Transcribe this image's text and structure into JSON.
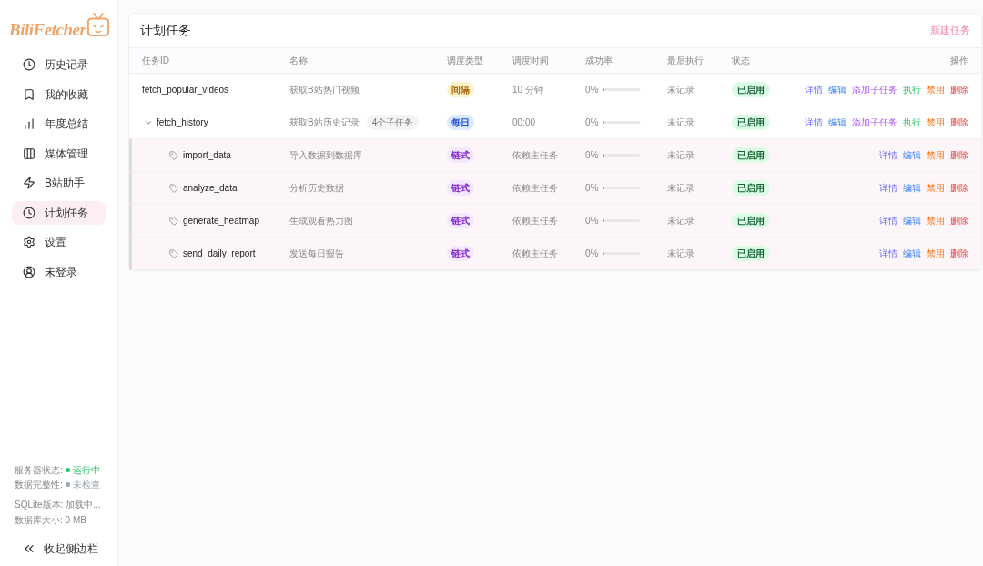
{
  "sidebar": {
    "logo": "BiliFetcher",
    "nav": [
      {
        "label": "历史记录",
        "selected": false
      },
      {
        "label": "我的收藏",
        "selected": false
      },
      {
        "label": "年度总结",
        "selected": false
      },
      {
        "label": "媒体管理",
        "selected": false
      },
      {
        "label": "B站助手",
        "selected": false
      },
      {
        "label": "计划任务",
        "selected": true
      },
      {
        "label": "设置",
        "selected": false
      },
      {
        "label": "未登录",
        "selected": false
      }
    ],
    "status": [
      {
        "label": "服务器状态:",
        "value": "运行中",
        "color": "#22c55e"
      },
      {
        "label": "数据完整性:",
        "value": "未检查",
        "color": "#9ca3af"
      }
    ],
    "info": [
      "SQLite版本: 加载中...",
      "数据库大小: 0 MB"
    ],
    "collapse": "收起侧边栏"
  },
  "page": {
    "title": "计划任务",
    "new_task": "新建任务"
  },
  "table": {
    "columns": [
      "任务ID",
      "名称",
      "调度类型",
      "调度时间",
      "成功率",
      "最后执行",
      "状态",
      "操作"
    ],
    "rows": [
      {
        "id": "fetch_popular_videos",
        "name": "获取B站热门视频",
        "schedule": {
          "kind": "interval",
          "label": "间隔"
        },
        "time": "10 分钟",
        "success": {
          "reading": "0%",
          "level": 0
        },
        "last_run": "未记录",
        "status": {
          "label": "已启用",
          "enabled": true
        },
        "actions": [
          {
            "kind": "detail",
            "label": "详情"
          },
          {
            "kind": "edit",
            "label": "编辑"
          },
          {
            "kind": "add_child",
            "label": "添加子任务"
          },
          {
            "kind": "run",
            "label": "执行"
          },
          {
            "kind": "disable",
            "label": "禁用"
          },
          {
            "kind": "delete",
            "label": "删除"
          }
        ]
      },
      {
        "id": "fetch_history",
        "expanded": true,
        "name": "获取B站历史记录",
        "subtask_count": "4个子任务",
        "schedule": {
          "kind": "daily",
          "label": "每日"
        },
        "time": "00:00",
        "success": {
          "reading": "0%",
          "level": 0
        },
        "last_run": "未记录",
        "status": {
          "label": "已启用",
          "enabled": true
        },
        "actions": [
          {
            "kind": "detail",
            "label": "详情"
          },
          {
            "kind": "edit",
            "label": "编辑"
          },
          {
            "kind": "add_child",
            "label": "添加子任务"
          },
          {
            "kind": "run",
            "label": "执行"
          },
          {
            "kind": "disable",
            "label": "禁用"
          },
          {
            "kind": "delete",
            "label": "删除"
          }
        ],
        "children": [
          {
            "id": "import_data",
            "name": "导入数据到数据库",
            "schedule": {
              "kind": "chain",
              "label": "链式"
            },
            "time": "依赖主任务",
            "success": {
              "reading": "0%",
              "level": 0
            },
            "last_run": "未记录",
            "status": {
              "label": "已启用",
              "enabled": true
            },
            "actions": [
              {
                "kind": "detail",
                "label": "详情"
              },
              {
                "kind": "edit",
                "label": "编辑"
              },
              {
                "kind": "disable",
                "label": "禁用"
              },
              {
                "kind": "delete",
                "label": "删除"
              }
            ]
          },
          {
            "id": "analyze_data",
            "name": "分析历史数据",
            "schedule": {
              "kind": "chain",
              "label": "链式"
            },
            "time": "依赖主任务",
            "success": {
              "reading": "0%",
              "level": 0
            },
            "last_run": "未记录",
            "status": {
              "label": "已启用",
              "enabled": true
            },
            "actions": [
              {
                "kind": "detail",
                "label": "详情"
              },
              {
                "kind": "edit",
                "label": "编辑"
              },
              {
                "kind": "disable",
                "label": "禁用"
              },
              {
                "kind": "delete",
                "label": "删除"
              }
            ]
          },
          {
            "id": "generate_heatmap",
            "name": "生成观看热力图",
            "schedule": {
              "kind": "chain",
              "label": "链式"
            },
            "time": "依赖主任务",
            "success": {
              "reading": "0%",
              "level": 0
            },
            "last_run": "未记录",
            "status": {
              "label": "已启用",
              "enabled": true
            },
            "actions": [
              {
                "kind": "detail",
                "label": "详情"
              },
              {
                "kind": "edit",
                "label": "编辑"
              },
              {
                "kind": "disable",
                "label": "禁用"
              },
              {
                "kind": "delete",
                "label": "删除"
              }
            ]
          },
          {
            "id": "send_daily_report",
            "name": "发送每日报告",
            "schedule": {
              "kind": "chain",
              "label": "链式"
            },
            "time": "依赖主任务",
            "success": {
              "reading": "0%",
              "level": 0
            },
            "last_run": "未记录",
            "status": {
              "label": "已启用",
              "enabled": true
            },
            "actions": [
              {
                "kind": "detail",
                "label": "详情"
              },
              {
                "kind": "edit",
                "label": "编辑"
              },
              {
                "kind": "disable",
                "label": "禁用"
              },
              {
                "kind": "delete",
                "label": "删除"
              }
            ]
          }
        ]
      }
    ]
  }
}
